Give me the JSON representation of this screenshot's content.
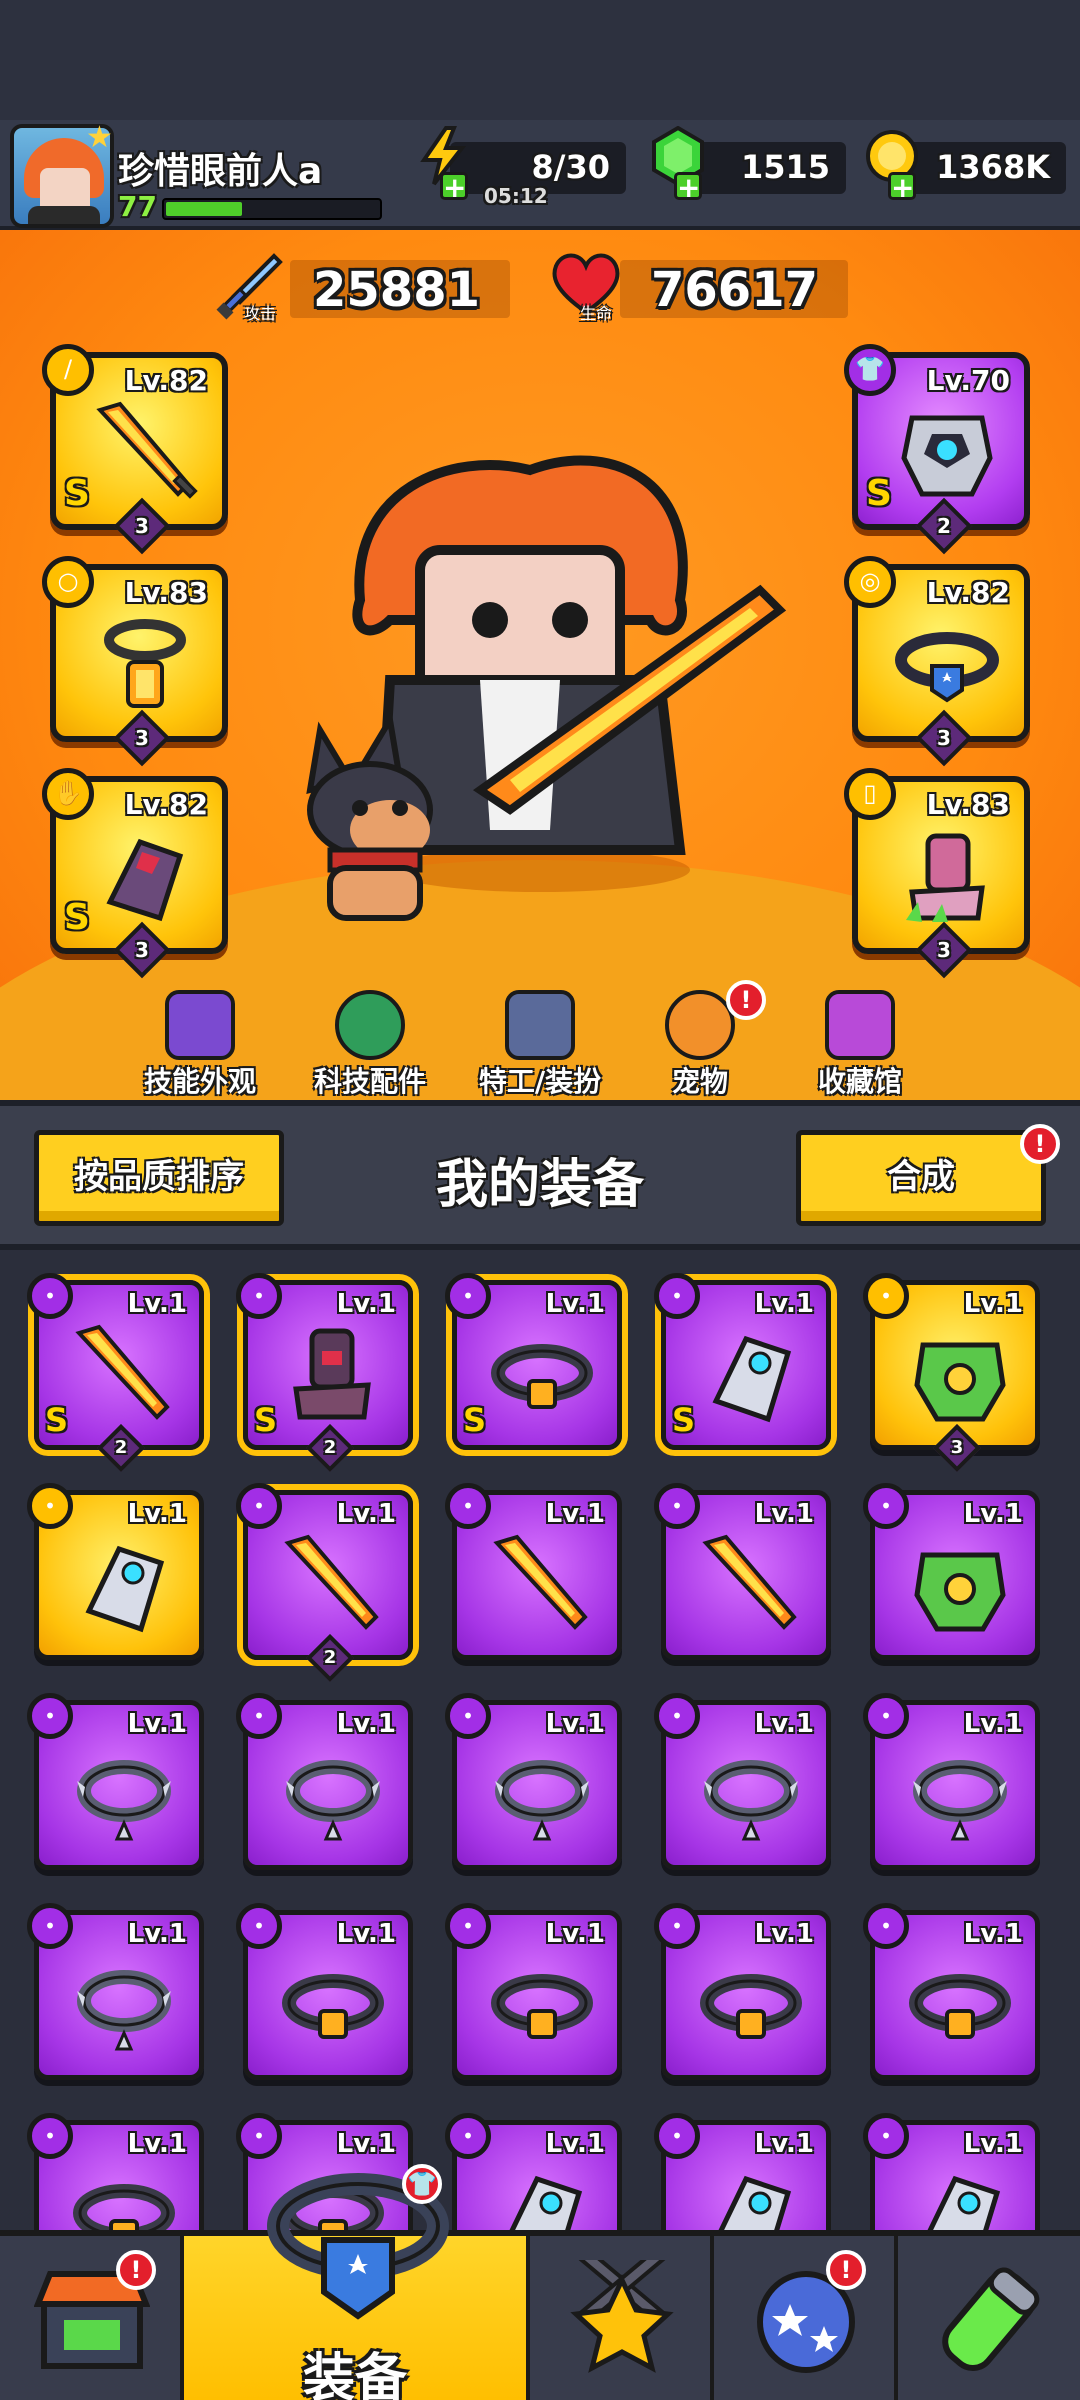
{
  "player": {
    "name": "珍惜眼前人a",
    "level": "77",
    "xp_fraction": 0.35
  },
  "resources": {
    "energy": "8/30",
    "energy_timer": "05:12",
    "gems": "1515",
    "gold": "1368K"
  },
  "stats": {
    "attack_value": "25881",
    "attack_label": "攻击",
    "hp_value": "76617",
    "hp_label": "生命"
  },
  "equipped": {
    "weapon": {
      "level": "Lv.82",
      "grade": "S",
      "stars": "3"
    },
    "necklace": {
      "level": "Lv.83",
      "stars": "3"
    },
    "glove": {
      "level": "Lv.82",
      "grade": "S",
      "stars": "3"
    },
    "armor": {
      "level": "Lv.70",
      "grade": "S",
      "stars": "2"
    },
    "belt": {
      "level": "Lv.82",
      "stars": "3"
    },
    "boots": {
      "level": "Lv.83",
      "stars": "3"
    }
  },
  "nav": {
    "skill_skin": "技能外观",
    "tech_parts": "科技配件",
    "agent_outfit": "特工/装扮",
    "pet": "宠物",
    "collection": "收藏馆",
    "alert": "!"
  },
  "equip_panel": {
    "sort_button": "按品质排序",
    "title": "我的装备",
    "merge_button": "合成",
    "alert": "!"
  },
  "inventory": [
    {
      "level": "Lv.1",
      "grade": "S",
      "stars": "2",
      "icon": "weapon-icon"
    },
    {
      "level": "Lv.1",
      "grade": "S",
      "stars": "2",
      "icon": "boots-icon"
    },
    {
      "level": "Lv.1",
      "grade": "S",
      "stars": "",
      "icon": "belt-icon"
    },
    {
      "level": "Lv.1",
      "grade": "S",
      "stars": "",
      "icon": "glove-icon"
    },
    {
      "level": "Lv.1",
      "grade": "",
      "stars": "3",
      "icon": "armor-icon"
    },
    {
      "level": "Lv.1",
      "grade": "",
      "stars": "",
      "icon": "glove-icon"
    },
    {
      "level": "Lv.1",
      "grade": "",
      "stars": "2",
      "icon": "weapon-icon"
    },
    {
      "level": "Lv.1",
      "grade": "",
      "stars": "",
      "icon": "weapon-icon"
    },
    {
      "level": "Lv.1",
      "grade": "",
      "stars": "",
      "icon": "weapon-icon"
    },
    {
      "level": "Lv.1",
      "grade": "",
      "stars": "",
      "icon": "armor-icon"
    },
    {
      "level": "Lv.1",
      "grade": "",
      "stars": "",
      "icon": "necklace-icon"
    },
    {
      "level": "Lv.1",
      "grade": "",
      "stars": "",
      "icon": "necklace-icon"
    },
    {
      "level": "Lv.1",
      "grade": "",
      "stars": "",
      "icon": "necklace-icon"
    },
    {
      "level": "Lv.1",
      "grade": "",
      "stars": "",
      "icon": "necklace-icon"
    },
    {
      "level": "Lv.1",
      "grade": "",
      "stars": "",
      "icon": "necklace-icon"
    },
    {
      "level": "Lv.1",
      "grade": "",
      "stars": "",
      "icon": "necklace-icon"
    },
    {
      "level": "Lv.1",
      "grade": "",
      "stars": "",
      "icon": "belt-icon"
    },
    {
      "level": "Lv.1",
      "grade": "",
      "stars": "",
      "icon": "belt-icon"
    },
    {
      "level": "Lv.1",
      "grade": "",
      "stars": "",
      "icon": "belt-icon"
    },
    {
      "level": "Lv.1",
      "grade": "",
      "stars": "",
      "icon": "belt-icon"
    },
    {
      "level": "Lv.1",
      "grade": "",
      "stars": "",
      "icon": "belt-icon"
    },
    {
      "level": "Lv.1",
      "grade": "",
      "stars": "",
      "icon": "belt-icon"
    },
    {
      "level": "Lv.1",
      "grade": "",
      "stars": "",
      "icon": "glove-icon"
    },
    {
      "level": "Lv.1",
      "grade": "",
      "stars": "",
      "icon": "glove-icon"
    },
    {
      "level": "Lv.1",
      "grade": "",
      "stars": "",
      "icon": "glove-icon"
    }
  ],
  "bottom_nav": {
    "equip_label": "装备",
    "alert": "!"
  },
  "colors": {
    "stage_orange": "#ff8a10",
    "epic_purple": "#a635e6",
    "legend_gold": "#ffc20a",
    "alert_red": "#e31f2c"
  }
}
